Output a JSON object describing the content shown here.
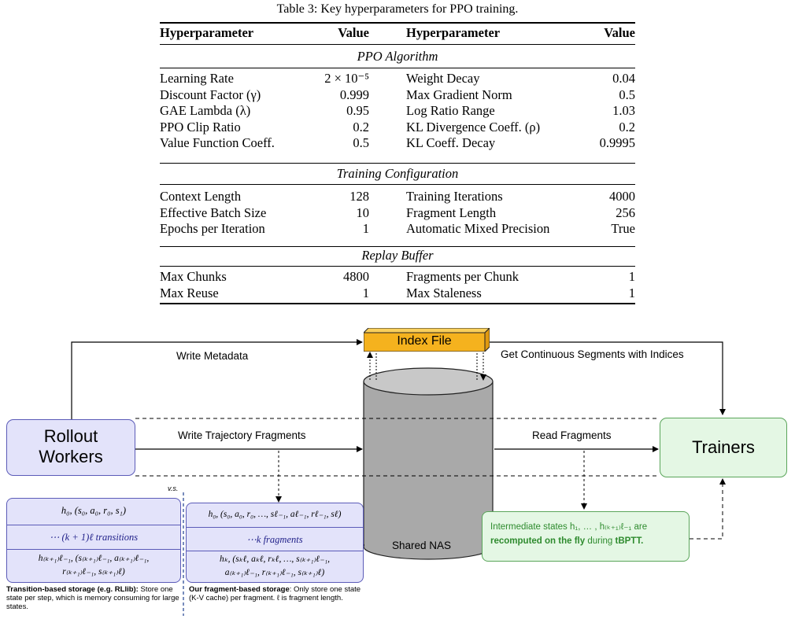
{
  "table": {
    "caption": "Table 3: Key hyperparameters for PPO training.",
    "headers": [
      "Hyperparameter",
      "Value",
      "Hyperparameter",
      "Value"
    ],
    "sections": [
      {
        "title": "PPO Algorithm",
        "rows": [
          [
            "Learning Rate",
            "2 × 10⁻⁵",
            "Weight Decay",
            "0.04"
          ],
          [
            "Discount Factor (γ)",
            "0.999",
            "Max Gradient Norm",
            "0.5"
          ],
          [
            "GAE Lambda (λ)",
            "0.95",
            "Log Ratio Range",
            "1.03"
          ],
          [
            "PPO Clip Ratio",
            "0.2",
            "KL Divergence Coeff. (ρ)",
            "0.2"
          ],
          [
            "Value Function Coeff.",
            "0.5",
            "KL Coeff. Decay",
            "0.9995"
          ]
        ]
      },
      {
        "title": "Training Configuration",
        "rows": [
          [
            "Context Length",
            "128",
            "Training Iterations",
            "4000"
          ],
          [
            "Effective Batch Size",
            "10",
            "Fragment Length",
            "256"
          ],
          [
            "Epochs per Iteration",
            "1",
            "Automatic Mixed Precision",
            "True"
          ]
        ]
      },
      {
        "title": "Replay Buffer",
        "rows": [
          [
            "Max Chunks",
            "4800",
            "Fragments per Chunk",
            "1"
          ],
          [
            "Max Reuse",
            "1",
            "Max Staleness",
            "1"
          ]
        ]
      }
    ]
  },
  "figure": {
    "index_file": "Index File",
    "write_metadata": "Write Metadata",
    "get_segments": "Get Continuous Segments with Indices",
    "rollout_line1": "Rollout",
    "rollout_line2": "Workers",
    "trainers": "Trainers",
    "write_fragments": "Write Trajectory Fragments",
    "read_fragments": "Read Fragments",
    "shared_nas": "Shared NAS",
    "vs": "v.s.",
    "transition_box": {
      "row1": "h₀, (s₀, a₀, r₀, s₁)",
      "row2": "⋯ (k + 1)ℓ transitions",
      "row3a": "h₍ₖ₊₁₎ℓ₋₁, (s₍ₖ₊₁₎ℓ₋₁, a₍ₖ₊₁₎ℓ₋₁,",
      "row3b": "r₍ₖ₊₁₎ℓ₋₁, s₍ₖ₊₁₎ℓ)"
    },
    "fragment_box": {
      "row1": "h₀, (s₀, a₀, r₀, …, sℓ₋₁, aℓ₋₁, rℓ₋₁, sℓ)",
      "row2": "⋯k fragments",
      "row3a": "hₖ, (sₖℓ, aₖℓ, rₖℓ, …, s₍ₖ₊₁₎ℓ₋₁,",
      "row3b": "a₍ₖ₊₁₎ℓ₋₁, r₍ₖ₊₁₎ℓ₋₁, s₍ₖ₊₁₎ℓ)"
    },
    "transition_note_bold": "Transition-based storage (e.g. RLlib):",
    "transition_note_rest": " Store one state per step, which is memory consuming for large states.",
    "fragment_note_bold": "Our fragment-based storage",
    "fragment_note_rest": ": Only store one state (K-V cache) per fragment. ℓ is fragment length.",
    "green_note_a": "Intermediate states h₁, … , h₍ₖ₊₁₎ℓ₋₁ are",
    "green_note_b1": "recomputed on the fly",
    "green_note_b2": " during ",
    "green_note_b3": "tBPTT.",
    "colors": {
      "index_orange": "#F5B21E",
      "worker_fill": "#E3E3FA",
      "worker_stroke": "#5B5BB8",
      "trainer_fill": "#E4F7E4",
      "trainer_stroke": "#5AA55A",
      "cylinder": "#A9A9A9",
      "green_text": "#2E8B2E",
      "blue_text": "#22228A"
    }
  }
}
